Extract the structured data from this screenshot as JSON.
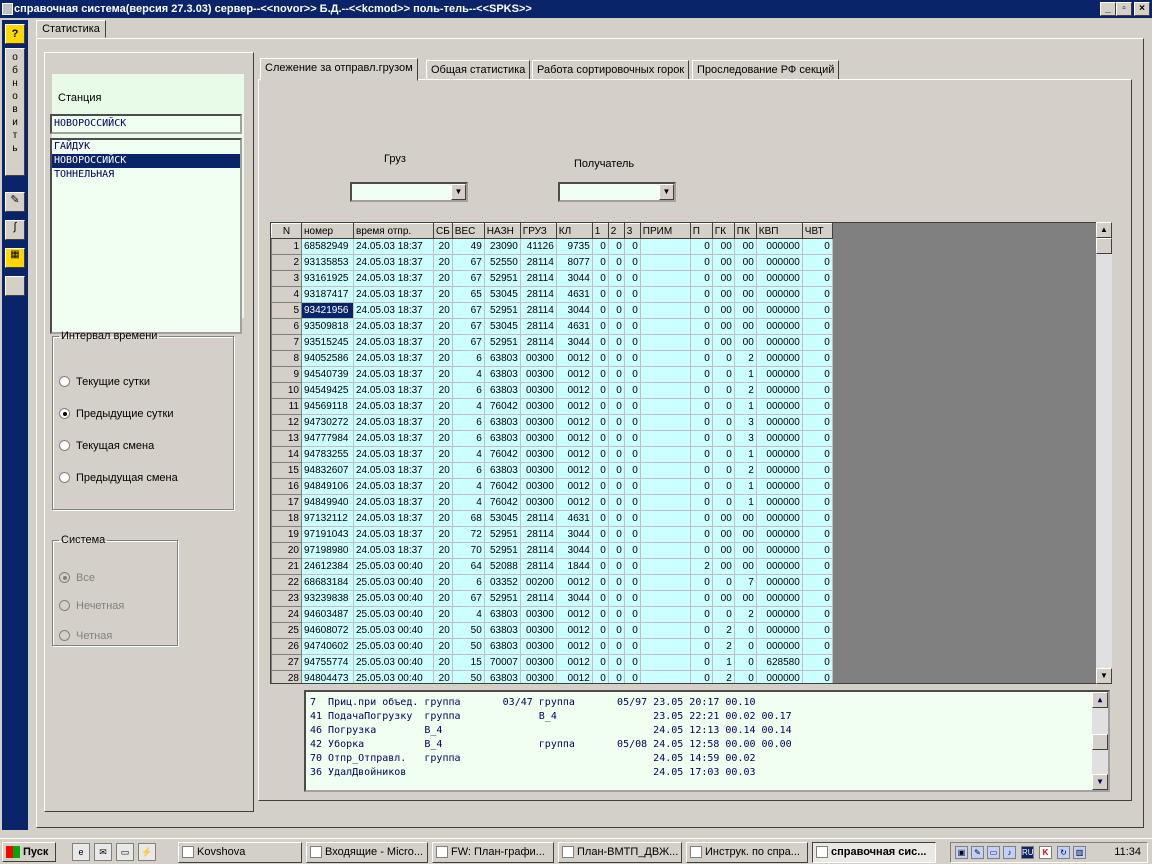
{
  "window": {
    "title": "справочная система(версия 27.3.03) сервер--<<novor>> Б.Д.--<<kcmod>> поль-тель--<<SPKS>>"
  },
  "sidebar": {
    "help": "?",
    "refresh_letters": [
      "о",
      "б",
      "н",
      "о",
      "в",
      "и",
      "т",
      "ь"
    ]
  },
  "outer_tab": "Статистика",
  "station": {
    "label": "Станция",
    "value": "НОВОРОССИЙСК",
    "list": [
      "ГАЙДУК",
      "НОВОРОССИЙСК",
      "ТОННЕЛЬНАЯ"
    ],
    "selected_index": 1
  },
  "interval": {
    "legend": "Интервал времени",
    "options": [
      "Текущие сутки",
      "Предыдущие сутки",
      "Текущая смена",
      "Предыдущая смена"
    ],
    "selected_index": 1
  },
  "system": {
    "legend": "Система",
    "options": [
      "Все",
      "Нечетная",
      "Четная"
    ],
    "selected_index": 0
  },
  "tabs": [
    "Слежение за отправл.грузом",
    "Общая статистика",
    "Работа сортировочных горок",
    "Проследование РФ секций"
  ],
  "active_tab": 0,
  "filters": {
    "cargo_label": "Груз",
    "cargo_value": "",
    "receiver_label": "Получатель",
    "receiver_value": ""
  },
  "grid": {
    "columns": [
      "N",
      "номер",
      "время отпр.",
      "СБ",
      "ВЕС",
      "НАЗН",
      "ГРУЗ",
      "КЛ",
      "1",
      "2",
      "3",
      "ПРИМ",
      "П",
      "ГК",
      "ПК",
      "КВП",
      "ЧВТ"
    ],
    "selected_row": 4,
    "rows": [
      [
        "1",
        "68582949",
        "24.05.03 18:37",
        "20",
        "49",
        "23090",
        "41126",
        "9735",
        "0",
        "0",
        "0",
        "",
        "0",
        "00",
        "00",
        "000000",
        "0"
      ],
      [
        "2",
        "93135853",
        "24.05.03 18:37",
        "20",
        "67",
        "52550",
        "28114",
        "8077",
        "0",
        "0",
        "0",
        "",
        "0",
        "00",
        "00",
        "000000",
        "0"
      ],
      [
        "3",
        "93161925",
        "24.05.03 18:37",
        "20",
        "67",
        "52951",
        "28114",
        "3044",
        "0",
        "0",
        "0",
        "",
        "0",
        "00",
        "00",
        "000000",
        "0"
      ],
      [
        "4",
        "93187417",
        "24.05.03 18:37",
        "20",
        "65",
        "53045",
        "28114",
        "4631",
        "0",
        "0",
        "0",
        "",
        "0",
        "00",
        "00",
        "000000",
        "0"
      ],
      [
        "5",
        "93421956",
        "24.05.03 18:37",
        "20",
        "67",
        "52951",
        "28114",
        "3044",
        "0",
        "0",
        "0",
        "",
        "0",
        "00",
        "00",
        "000000",
        "0"
      ],
      [
        "6",
        "93509818",
        "24.05.03 18:37",
        "20",
        "67",
        "53045",
        "28114",
        "4631",
        "0",
        "0",
        "0",
        "",
        "0",
        "00",
        "00",
        "000000",
        "0"
      ],
      [
        "7",
        "93515245",
        "24.05.03 18:37",
        "20",
        "67",
        "52951",
        "28114",
        "3044",
        "0",
        "0",
        "0",
        "",
        "0",
        "00",
        "00",
        "000000",
        "0"
      ],
      [
        "8",
        "94052586",
        "24.05.03 18:37",
        "20",
        "6",
        "63803",
        "00300",
        "0012",
        "0",
        "0",
        "0",
        "",
        "0",
        "0",
        "2",
        "000000",
        "0"
      ],
      [
        "9",
        "94540739",
        "24.05.03 18:37",
        "20",
        "4",
        "63803",
        "00300",
        "0012",
        "0",
        "0",
        "0",
        "",
        "0",
        "0",
        "1",
        "000000",
        "0"
      ],
      [
        "10",
        "94549425",
        "24.05.03 18:37",
        "20",
        "6",
        "63803",
        "00300",
        "0012",
        "0",
        "0",
        "0",
        "",
        "0",
        "0",
        "2",
        "000000",
        "0"
      ],
      [
        "11",
        "94569118",
        "24.05.03 18:37",
        "20",
        "4",
        "76042",
        "00300",
        "0012",
        "0",
        "0",
        "0",
        "",
        "0",
        "0",
        "1",
        "000000",
        "0"
      ],
      [
        "12",
        "94730272",
        "24.05.03 18:37",
        "20",
        "6",
        "63803",
        "00300",
        "0012",
        "0",
        "0",
        "0",
        "",
        "0",
        "0",
        "3",
        "000000",
        "0"
      ],
      [
        "13",
        "94777984",
        "24.05.03 18:37",
        "20",
        "6",
        "63803",
        "00300",
        "0012",
        "0",
        "0",
        "0",
        "",
        "0",
        "0",
        "3",
        "000000",
        "0"
      ],
      [
        "14",
        "94783255",
        "24.05.03 18:37",
        "20",
        "4",
        "76042",
        "00300",
        "0012",
        "0",
        "0",
        "0",
        "",
        "0",
        "0",
        "1",
        "000000",
        "0"
      ],
      [
        "15",
        "94832607",
        "24.05.03 18:37",
        "20",
        "6",
        "63803",
        "00300",
        "0012",
        "0",
        "0",
        "0",
        "",
        "0",
        "0",
        "2",
        "000000",
        "0"
      ],
      [
        "16",
        "94849106",
        "24.05.03 18:37",
        "20",
        "4",
        "76042",
        "00300",
        "0012",
        "0",
        "0",
        "0",
        "",
        "0",
        "0",
        "1",
        "000000",
        "0"
      ],
      [
        "17",
        "94849940",
        "24.05.03 18:37",
        "20",
        "4",
        "76042",
        "00300",
        "0012",
        "0",
        "0",
        "0",
        "",
        "0",
        "0",
        "1",
        "000000",
        "0"
      ],
      [
        "18",
        "97132112",
        "24.05.03 18:37",
        "20",
        "68",
        "53045",
        "28114",
        "4631",
        "0",
        "0",
        "0",
        "",
        "0",
        "00",
        "00",
        "000000",
        "0"
      ],
      [
        "19",
        "97191043",
        "24.05.03 18:37",
        "20",
        "72",
        "52951",
        "28114",
        "3044",
        "0",
        "0",
        "0",
        "",
        "0",
        "00",
        "00",
        "000000",
        "0"
      ],
      [
        "20",
        "97198980",
        "24.05.03 18:37",
        "20",
        "70",
        "52951",
        "28114",
        "3044",
        "0",
        "0",
        "0",
        "",
        "0",
        "00",
        "00",
        "000000",
        "0"
      ],
      [
        "21",
        "24612384",
        "25.05.03 00:40",
        "20",
        "64",
        "52088",
        "28114",
        "1844",
        "0",
        "0",
        "0",
        "",
        "2",
        "00",
        "00",
        "000000",
        "0"
      ],
      [
        "22",
        "68683184",
        "25.05.03 00:40",
        "20",
        "6",
        "03352",
        "00200",
        "0012",
        "0",
        "0",
        "0",
        "",
        "0",
        "0",
        "7",
        "000000",
        "0"
      ],
      [
        "23",
        "93239838",
        "25.05.03 00:40",
        "20",
        "67",
        "52951",
        "28114",
        "3044",
        "0",
        "0",
        "0",
        "",
        "0",
        "00",
        "00",
        "000000",
        "0"
      ],
      [
        "24",
        "94603487",
        "25.05.03 00:40",
        "20",
        "4",
        "63803",
        "00300",
        "0012",
        "0",
        "0",
        "0",
        "",
        "0",
        "0",
        "2",
        "000000",
        "0"
      ],
      [
        "25",
        "94608072",
        "25.05.03 00:40",
        "20",
        "50",
        "63803",
        "00300",
        "0012",
        "0",
        "0",
        "0",
        "",
        "0",
        "2",
        "0",
        "000000",
        "0"
      ],
      [
        "26",
        "94740602",
        "25.05.03 00:40",
        "20",
        "50",
        "63803",
        "00300",
        "0012",
        "0",
        "0",
        "0",
        "",
        "0",
        "2",
        "0",
        "000000",
        "0"
      ],
      [
        "27",
        "94755774",
        "25.05.03 00:40",
        "20",
        "15",
        "70007",
        "00300",
        "0012",
        "0",
        "0",
        "0",
        "",
        "0",
        "1",
        "0",
        "628580",
        "0"
      ],
      [
        "28",
        "94804473",
        "25.05.03 00:40",
        "20",
        "50",
        "63803",
        "00300",
        "0012",
        "0",
        "0",
        "0",
        "",
        "0",
        "2",
        "0",
        "000000",
        "0"
      ]
    ]
  },
  "log_lines": [
    "7  Приц.при объед. группа       03/47 группа       05/97 23.05 20:17 00.10",
    "41 ПодачаПогрузку  группа             В_4                23.05 22:21 00.02 00.17",
    "46 Погрузка        В_4                                   24.05 12:13 00.14 00.14",
    "42 Уборка          В_4                группа       05/08 24.05 12:58 00.00 00.00",
    "70 Отпр_Отправл.   группа                                24.05 14:59 00.02",
    "36 УдалДвойников                                         24.05 17:03 00.03"
  ],
  "taskbar": {
    "start": "Пуск",
    "tasks": [
      "Kovshova",
      "Входящие - Micro...",
      "FW: План-графи...",
      "План-ВМТП_ДВЖ...",
      "Инструк. по спра...",
      "справочная сис..."
    ],
    "active_task": 5,
    "clock": "11:34",
    "lang": "RU"
  }
}
